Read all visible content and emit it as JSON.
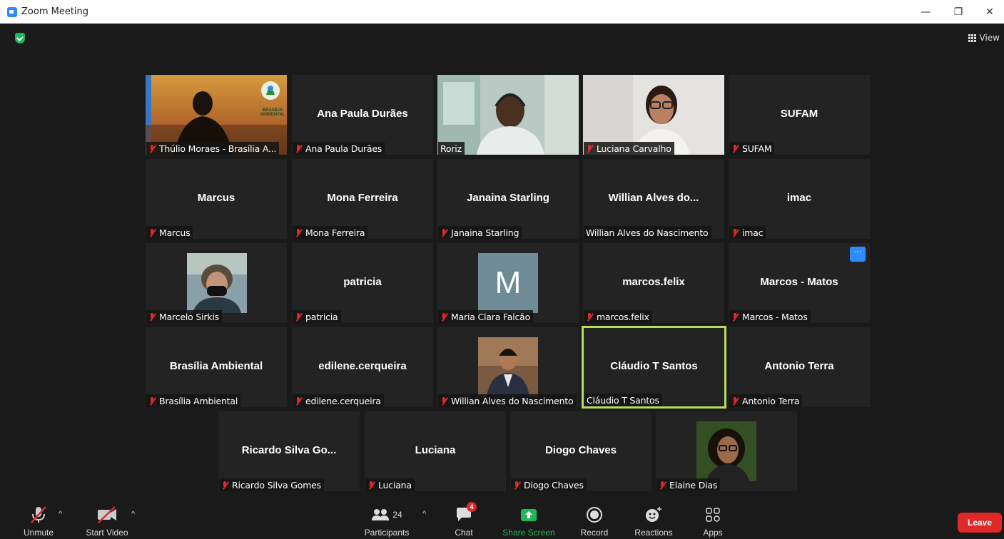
{
  "window": {
    "title": "Zoom Meeting",
    "minimize": "—",
    "restore": "❐",
    "close": "✕"
  },
  "header": {
    "view_label": "View"
  },
  "participants_tiles": [
    {
      "name": "Thúlio Moraes - Brasília A...",
      "big": ""
    },
    {
      "name": "Ana Paula Durães",
      "big": "Ana Paula Durães"
    },
    {
      "name": "Roriz",
      "big": ""
    },
    {
      "name": "Luciana Carvalho",
      "big": ""
    },
    {
      "name": "SUFAM",
      "big": "SUFAM"
    },
    {
      "name": "Marcus",
      "big": "Marcus"
    },
    {
      "name": "Mona Ferreira",
      "big": "Mona Ferreira"
    },
    {
      "name": "Janaina Starling",
      "big": "Janaina Starling"
    },
    {
      "name": "Willian Alves do Nascimento",
      "big": "Willian Alves do..."
    },
    {
      "name": "imac",
      "big": "imac"
    },
    {
      "name": "Marcelo Sirkis",
      "big": ""
    },
    {
      "name": "patricia",
      "big": "patricia"
    },
    {
      "name": "Maria Clara Falcão",
      "big": "",
      "avatar_letter": "M"
    },
    {
      "name": "marcos.felix",
      "big": "marcos.felix"
    },
    {
      "name": "Marcos - Matos",
      "big": "Marcos - Matos",
      "more": "···"
    },
    {
      "name": "Brasília Ambiental",
      "big": "Brasília Ambiental"
    },
    {
      "name": "edilene.cerqueira",
      "big": "edilene.cerqueira"
    },
    {
      "name": "Willian Alves do Nascimento",
      "big": ""
    },
    {
      "name": "Cláudio T Santos",
      "big": "Cláudio T Santos"
    },
    {
      "name": "Antonio Terra",
      "big": "Antonio Terra"
    },
    {
      "name": "Ricardo Silva Gomes",
      "big": "Ricardo Silva Go..."
    },
    {
      "name": "Luciana",
      "big": "Luciana"
    },
    {
      "name": "Diogo Chaves",
      "big": "Diogo Chaves"
    },
    {
      "name": "Elaine Dias",
      "big": ""
    }
  ],
  "thumb_text": {
    "brasilia_logo": "BRASÍLIA AMBIENTAL"
  },
  "toolbar": {
    "unmute": "Unmute",
    "start_video": "Start Video",
    "participants": "Participants",
    "participants_count": "24",
    "chat": "Chat",
    "chat_badge": "4",
    "share_screen": "Share Screen",
    "record": "Record",
    "reactions": "Reactions",
    "apps": "Apps",
    "leave": "Leave"
  },
  "colors": {
    "active_speaker": "#b9dd59",
    "share_green": "#1fb75b",
    "leave_red": "#e02828",
    "accent_blue": "#2d8cff"
  }
}
